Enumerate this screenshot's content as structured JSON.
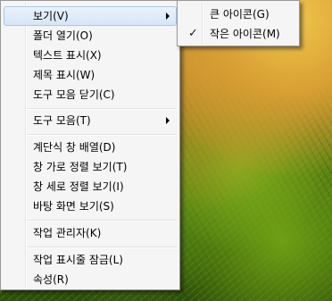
{
  "context_menu": {
    "items": [
      {
        "label": "보기(V)",
        "has_submenu": true,
        "highlighted": true
      },
      {
        "label": "폴더 열기(O)"
      },
      {
        "label": "텍스트 표시(X)"
      },
      {
        "label": "제목 표시(W)"
      },
      {
        "label": "도구 모음 닫기(C)"
      },
      {
        "label": "도구 모음(T)",
        "has_submenu": true
      },
      {
        "label": "계단식 창 배열(D)"
      },
      {
        "label": "창 가로 정렬 보기(T)"
      },
      {
        "label": "창 세로 정렬 보기(I)"
      },
      {
        "label": "바탕 화면 보기(S)"
      },
      {
        "label": "작업 관리자(K)"
      },
      {
        "label": "작업 표시줄 잠금(L)"
      },
      {
        "label": "속성(R)"
      }
    ]
  },
  "view_submenu": {
    "items": [
      {
        "label": "큰 아이콘(G)",
        "checked": false
      },
      {
        "label": "작은 아이콘(M)",
        "checked": true
      }
    ],
    "check_glyph": "✓"
  },
  "colors": {
    "menu_background": "#f5f5f5",
    "menu_border": "#979797",
    "highlight_border": "#a8c8ec",
    "highlight_fill": "#d6e6f8"
  },
  "icons": {
    "submenu_arrow": "chevron-right-icon",
    "checkmark": "checkmark-icon"
  }
}
